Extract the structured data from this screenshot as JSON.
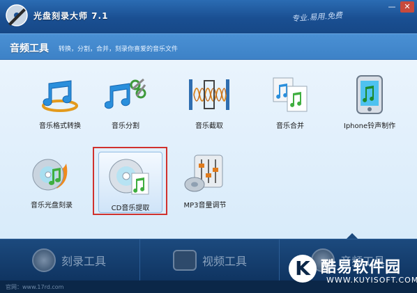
{
  "window": {
    "title": "光盘刻录大师 7.1",
    "slogan": "专业.易用.免费",
    "minimize_icon": "minimize-icon",
    "close_icon": "close-icon",
    "minimize_label": "—",
    "close_label": "✕"
  },
  "section": {
    "title": "音频工具",
    "subtitle": "转换，分割，合并，刻录你喜爱的音乐文件"
  },
  "tools": [
    {
      "label": "音乐格式转换",
      "icon": "music-convert-icon"
    },
    {
      "label": "音乐分割",
      "icon": "music-split-icon"
    },
    {
      "label": "音乐截取",
      "icon": "music-clip-icon"
    },
    {
      "label": "音乐合并",
      "icon": "music-merge-icon"
    },
    {
      "label": "Iphone铃声制作",
      "icon": "iphone-ringtone-icon"
    },
    {
      "label": "音乐光盘刻录",
      "icon": "music-disc-burn-icon"
    },
    {
      "label": "CD音乐提取",
      "icon": "cd-extract-icon",
      "selected": true
    },
    {
      "label": "MP3音量调节",
      "icon": "mp3-volume-icon"
    }
  ],
  "bottom_tabs": [
    {
      "label": "刻录工具",
      "icon": "disc-icon"
    },
    {
      "label": "视频工具",
      "icon": "film-icon"
    },
    {
      "label": "音频工具",
      "icon": "audio-icon",
      "active": true
    }
  ],
  "footer": {
    "text": "官网：www.17rd.com"
  },
  "watermark": {
    "letter": "K",
    "name": "酷易软件园",
    "domain": "WWW.KUYISOFT.COM"
  },
  "colors": {
    "accent": "#1a4f92",
    "selection_frame": "#d0312d"
  }
}
